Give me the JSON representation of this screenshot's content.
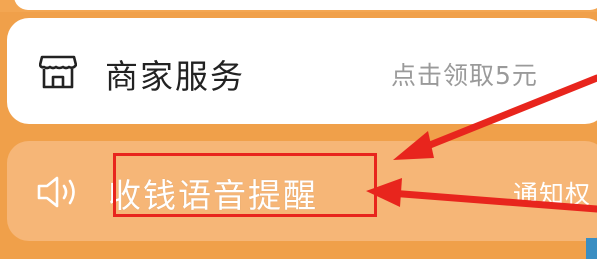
{
  "merchant_service": {
    "label": "商家服务",
    "hint": "点击领取5元",
    "icon": "store-icon"
  },
  "voice_alert": {
    "label": "收钱语音提醒",
    "hint": "通知权",
    "icon": "speaker-icon"
  },
  "annotation": {
    "highlight_color": "#e8251d",
    "arrow_color": "#e8251d"
  },
  "colors": {
    "background": "#f0a04a",
    "card_white": "#ffffff",
    "card_faded": "#f6b677"
  }
}
